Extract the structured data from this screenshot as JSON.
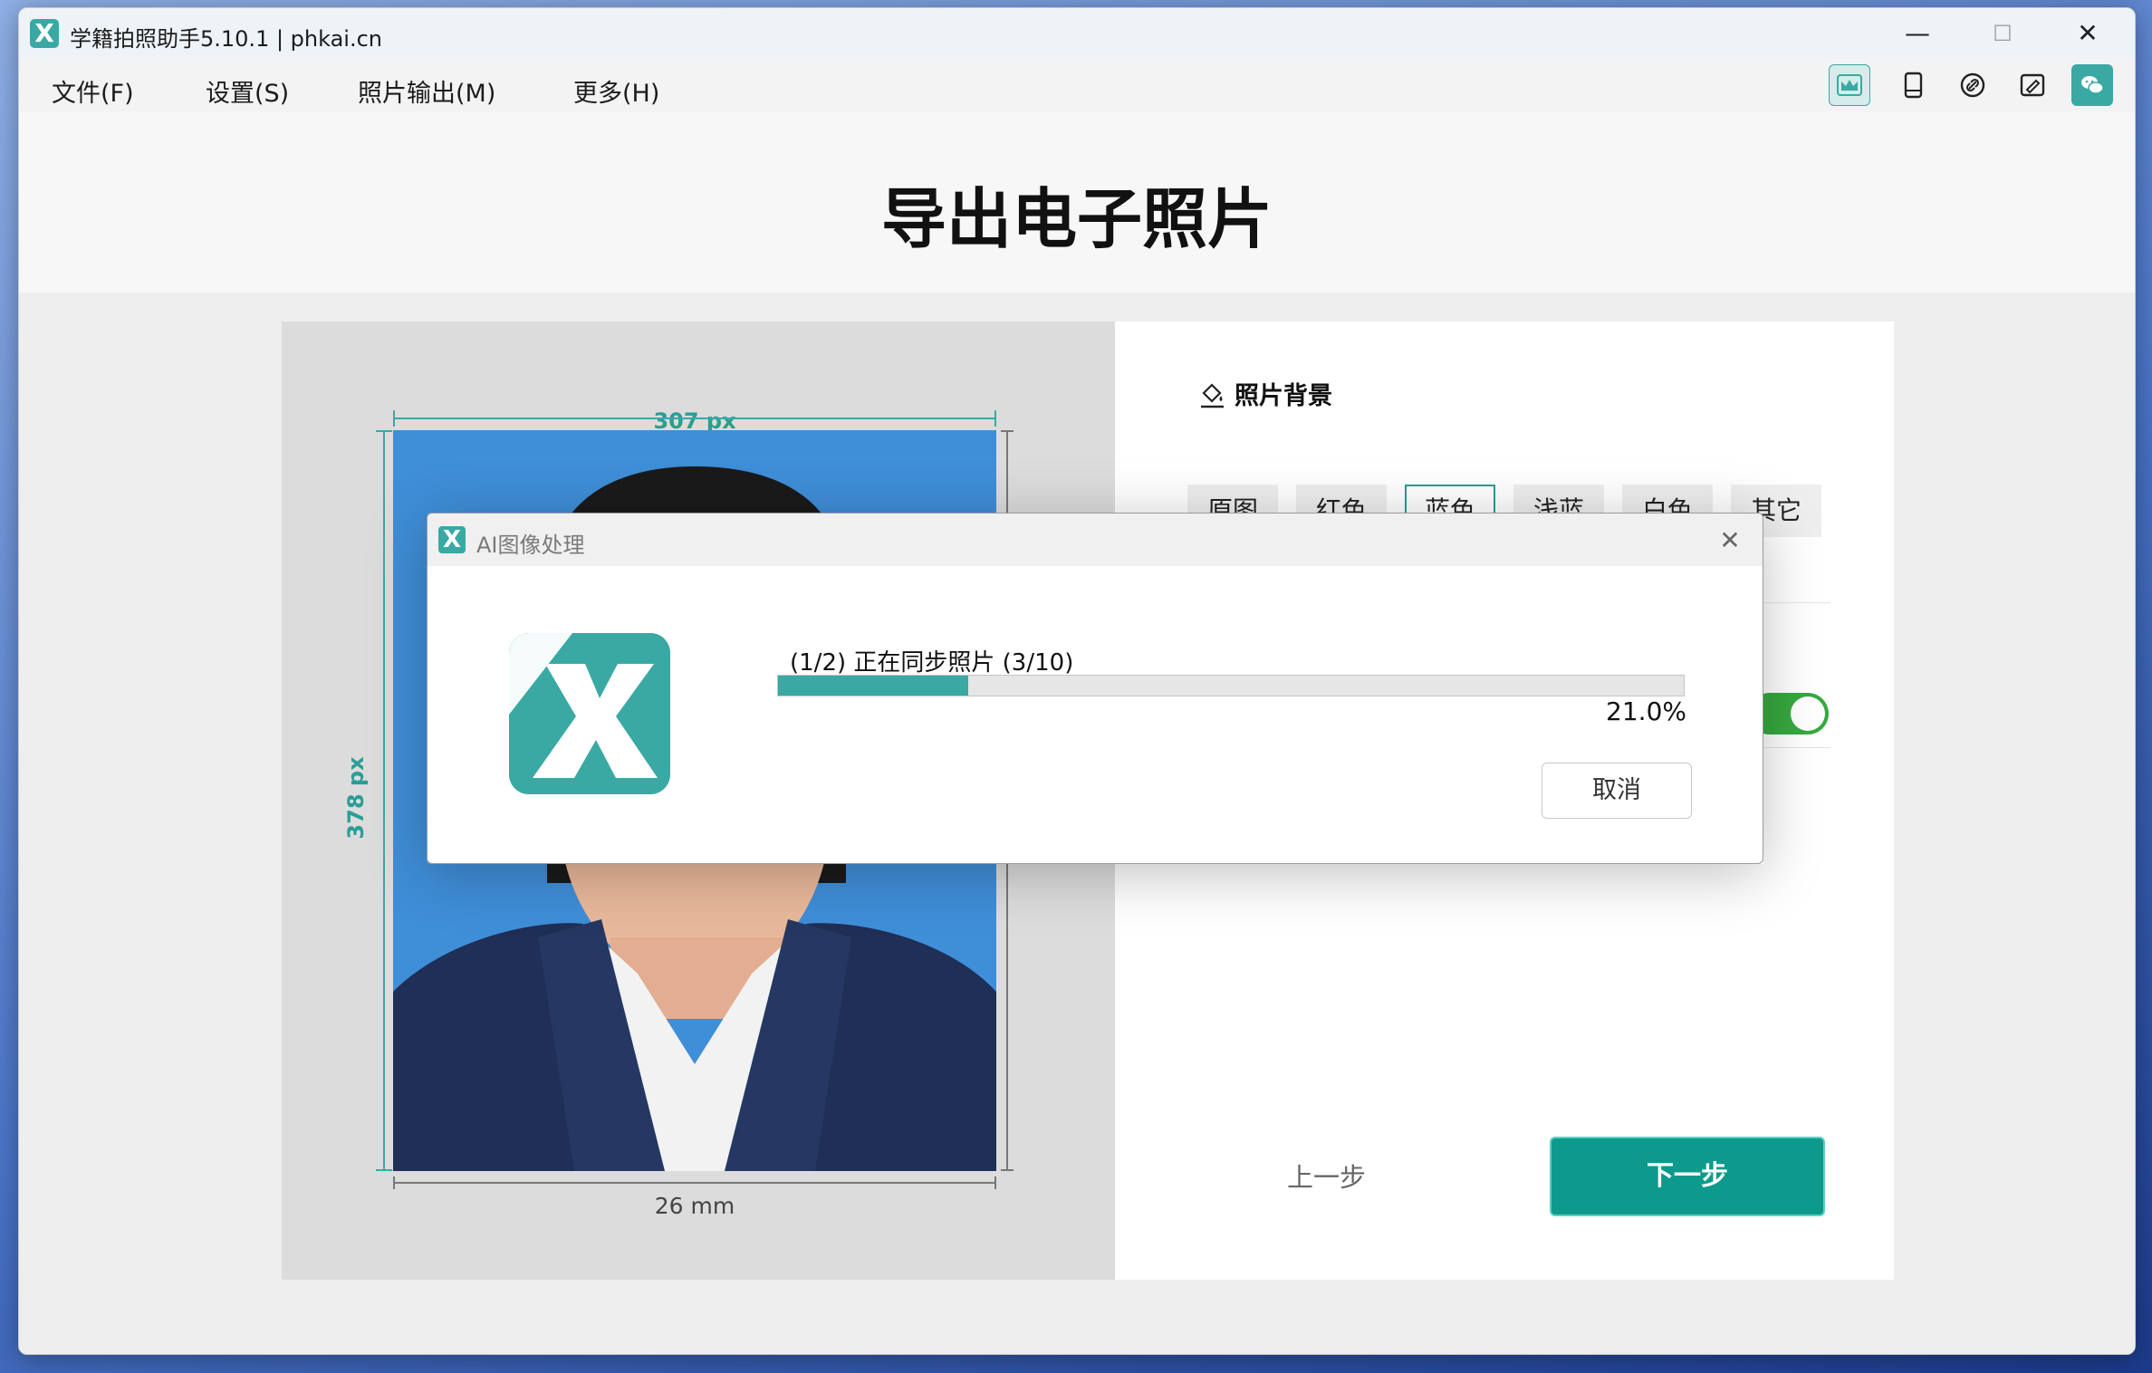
{
  "window": {
    "title": "学籍拍照助手5.10.1 | phkai.cn",
    "minimize_glyph": "—",
    "maximize_glyph": "☐",
    "close_glyph": "✕"
  },
  "menu": {
    "items": [
      "文件(F)",
      "设置(S)",
      "照片输出(M)",
      "更多(H)"
    ]
  },
  "toolbar": {
    "icons": [
      "crown-icon",
      "tablet-icon",
      "link-icon",
      "edit-image-icon",
      "wechat-icon"
    ],
    "active_index": 0
  },
  "page": {
    "title": "导出电子照片"
  },
  "preview": {
    "width_label": "307 px",
    "height_label": "378 px",
    "mm_label": "26 mm"
  },
  "background_settings": {
    "section_title": "照片背景",
    "options": [
      "原图",
      "红色",
      "蓝色",
      "浅蓝",
      "白色",
      "其它"
    ],
    "selected_index": 2,
    "toggle_on": true
  },
  "navigation": {
    "prev_label": "上一步",
    "next_label": "下一步"
  },
  "dialog": {
    "title": "AI图像处理",
    "progress_text": "(1/2)  正在同步照片 (3/10)",
    "progress_percent_text": "21.0%",
    "progress_value": 0.21,
    "cancel_label": "取消"
  },
  "colors": {
    "brand": "#3aa9a4",
    "next_button": "#0d9a8c",
    "toggle": "#36a93f",
    "photo_background": "#3f8ed8"
  }
}
